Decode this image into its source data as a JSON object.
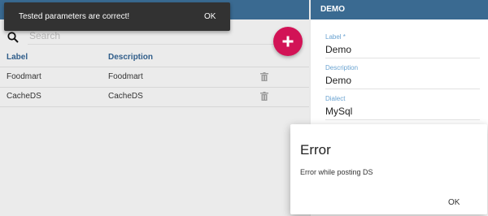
{
  "snackbar": {
    "message": "Tested parameters are correct!",
    "action": "OK"
  },
  "search": {
    "placeholder": "Search"
  },
  "table": {
    "headers": {
      "label": "Label",
      "description": "Description"
    },
    "rows": [
      {
        "label": "Foodmart",
        "description": "Foodmart"
      },
      {
        "label": "CacheDS",
        "description": "CacheDS"
      }
    ]
  },
  "detail": {
    "title": "DEMO",
    "fields": [
      {
        "label": "Label *",
        "value": "Demo"
      },
      {
        "label": "Description",
        "value": "Demo"
      },
      {
        "label": "Dialect",
        "value": "MySql"
      }
    ]
  },
  "dialog": {
    "title": "Error",
    "message": "Error while posting DS",
    "action": "OK"
  },
  "colors": {
    "header_bar": "#3a6a91",
    "fab": "#d21356",
    "snackbar": "#323232",
    "field_label": "#6aa3d1",
    "column_header": "#2f5d8a"
  },
  "icons": {
    "search": "search-icon",
    "add": "plus-icon",
    "delete": "trash-icon"
  }
}
